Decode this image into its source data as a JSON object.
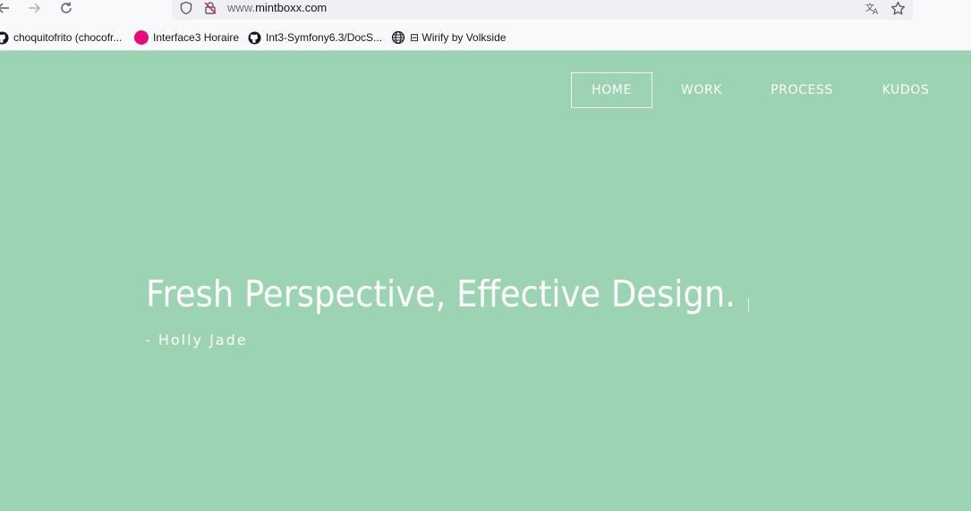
{
  "browser": {
    "url_prefix": "www.",
    "url_domain": "mintboxx.com",
    "bookmarks": [
      {
        "label": "choquitofrito (chocofr...",
        "icon": "github-icon"
      },
      {
        "label": "Interface3 Horaire",
        "icon": "pink-dot-icon"
      },
      {
        "label": "Int3-Symfony6.3/DocS...",
        "icon": "github-icon"
      },
      {
        "label": "⊟ Wirify by Volkside",
        "icon": "globe-icon"
      }
    ]
  },
  "colors": {
    "page_background": "#9cd3b2",
    "text": "#ffffff",
    "bookmark_pink": "#e8097a"
  },
  "site": {
    "nav": [
      {
        "label": "HOME",
        "active": true
      },
      {
        "label": "WORK",
        "active": false
      },
      {
        "label": "PROCESS",
        "active": false
      },
      {
        "label": "KUDOS",
        "active": false
      }
    ],
    "hero_title": "Fresh Perspective, Effective Design.",
    "hero_author": "- Holly Jade"
  }
}
